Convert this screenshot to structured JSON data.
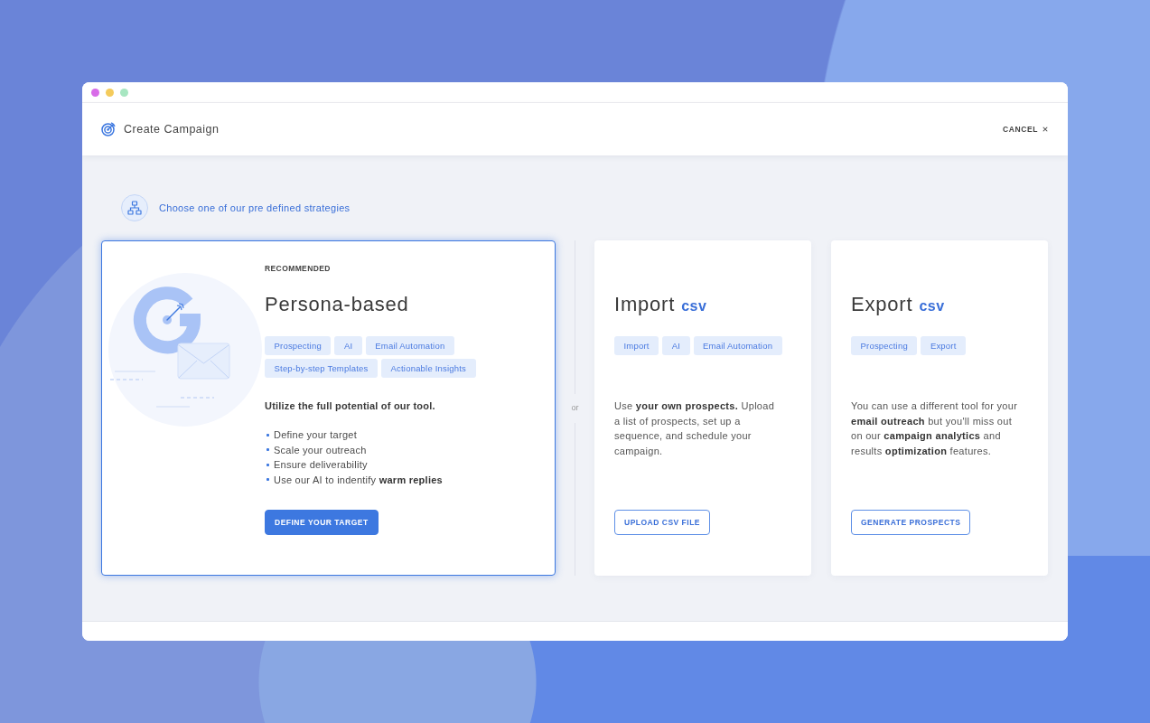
{
  "window": {
    "title": "Create Campaign",
    "cancel": "CANCEL"
  },
  "intro": {
    "text": "Choose one of our pre defined strategies"
  },
  "strategies": [
    {
      "kind": "persona",
      "selected": true,
      "eyebrow": "RECOMMENDED",
      "title": "Persona-based",
      "tags": [
        "Prospecting",
        "AI",
        "Email Automation",
        "Step-by-step Templates",
        "Actionable Insights"
      ],
      "lead": "Utilize the full potential of our tool.",
      "bullets": [
        "Define your target",
        "Scale your outreach",
        "Ensure deliverability",
        "Use our AI to indentify **warm replies**"
      ],
      "button": "DEFINE YOUR TARGET"
    },
    {
      "kind": "file",
      "selected": false,
      "title": "Import",
      "format": "csv",
      "tags": [
        "Import",
        "AI",
        "Email Automation"
      ],
      "description": "Use **your own prospects.** Upload a list of prospects, set up a sequence, and schedule your campaign.",
      "button": "UPLOAD CSV FILE"
    },
    {
      "kind": "file",
      "selected": false,
      "title": "Export",
      "format": "csv",
      "tags": [
        "Prospecting",
        "Export"
      ],
      "description": "You can use a different tool for your **email outreach** but you'll miss out on our **campaign analytics** and results **optimization** features.",
      "button": "GENERATE PROSPECTS"
    }
  ],
  "separator": "or"
}
